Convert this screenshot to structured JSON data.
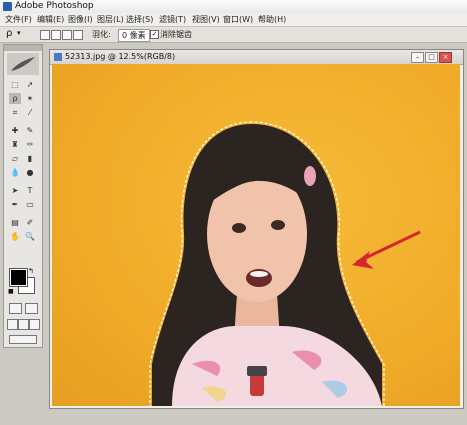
{
  "app": {
    "title": "Adobe Photoshop"
  },
  "menubar": {
    "items": [
      "文件(F)",
      "编辑(E)",
      "图像(I)",
      "图层(L)",
      "选择(S)",
      "滤镜(T)",
      "视图(V)",
      "窗口(W)",
      "帮助(H)"
    ]
  },
  "options": {
    "feather_label": "羽化:",
    "feather_value": "0 像素",
    "antialias_label": "消除锯齿",
    "antialias_checked": true
  },
  "document": {
    "title": "52313.jpg @ 12.5%(RGB/8)"
  },
  "colors": {
    "background_yellow": "#f0ab28",
    "arrow_red": "#d6262e",
    "foreground": "#000000",
    "background_swatch": "#ffffff"
  },
  "icons": [
    "lasso-icon",
    "marquee-icon",
    "move-icon",
    "crop-icon",
    "brush-icon",
    "eraser-icon",
    "text-icon",
    "hand-icon",
    "zoom-icon"
  ]
}
